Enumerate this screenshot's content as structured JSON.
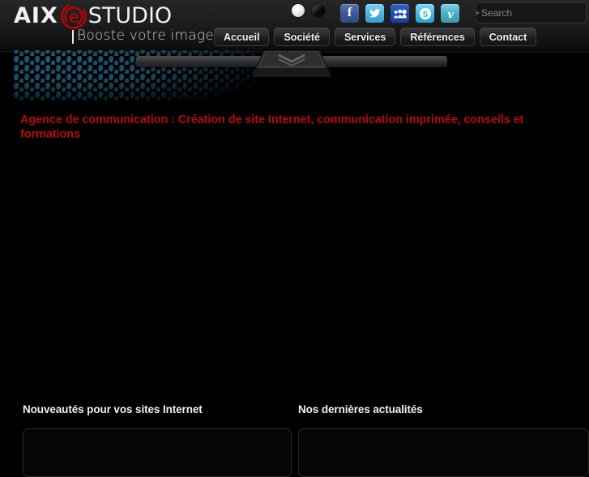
{
  "site": {
    "logo": {
      "part1": "AIX",
      "letter_e": "e",
      "part2": "STUDIO",
      "tagline": "Booste votre image",
      "accent_color": "#cc0000"
    }
  },
  "header": {
    "style_switcher": [
      {
        "name": "light-style",
        "label": "Light style"
      },
      {
        "name": "dark-style",
        "label": "Dark style"
      }
    ],
    "social": [
      {
        "icon": "facebook-icon",
        "label": "Facebook",
        "color": "#3b5998"
      },
      {
        "icon": "twitter-icon",
        "label": "Twitter",
        "color": "#4cb3dc"
      },
      {
        "icon": "myspace-icon",
        "label": "MySpace",
        "color": "#1d4eb5"
      },
      {
        "icon": "skype-icon",
        "label": "Skype",
        "color": "#3fb7e2"
      },
      {
        "icon": "vimeo-icon",
        "label": "Vimeo",
        "color": "#46aec2"
      }
    ],
    "search": {
      "placeholder": "Search",
      "value": "",
      "caret": "▸",
      "button_icon": "search-icon"
    },
    "nav": [
      {
        "label": "Accueil"
      },
      {
        "label": "Société"
      },
      {
        "label": "Services"
      },
      {
        "label": "Références"
      },
      {
        "label": "Contact"
      }
    ]
  },
  "hero": {
    "slider_control_icon": "chevron-down-icon"
  },
  "main": {
    "headline": "Agence de communication : Création de site Internet, communication imprimée, conseils et formations",
    "headline_color": "#b60a0a"
  },
  "columns": {
    "left": {
      "title": "Nouveautés pour vos sites Internet"
    },
    "right": {
      "title": "Nos dernières actualités"
    }
  }
}
